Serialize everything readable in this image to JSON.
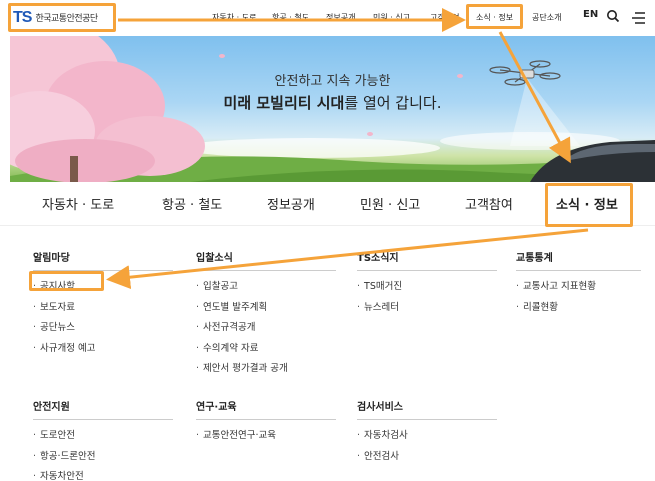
{
  "header": {
    "logo_mark": "TS",
    "logo_text": "한국교통안전공단",
    "top_nav": [
      "자동차 · 도로",
      "항공 · 철도",
      "정보공개",
      "민원 · 신고",
      "고객참여",
      "소식 · 정보",
      "공단소개"
    ],
    "lang_label": "EN"
  },
  "hero": {
    "line1": "안전하고 지속 가능한",
    "line2_bold": "미래 모빌리티 시대",
    "line2_rest": "를 열어 갑니다."
  },
  "gnb": {
    "items": [
      "자동차 · 도로",
      "항공 · 철도",
      "정보공개",
      "민원 · 신고",
      "고객참여",
      "소식 · 정보"
    ]
  },
  "mega": {
    "columns": [
      {
        "title": "알림마당",
        "items": [
          "공지사항",
          "보도자료",
          "공단뉴스",
          "사규개정 예고"
        ]
      },
      {
        "title": "입찰소식",
        "items": [
          "입찰공고",
          "연도별 발주계획",
          "사전규격공개",
          "수의계약 자료",
          "제안서 평가결과 공개"
        ]
      },
      {
        "title": "TS소식지",
        "items": [
          "TS매거진",
          "뉴스레터"
        ]
      },
      {
        "title": "교통통계",
        "items": [
          "교통사고 지표현황",
          "리콜현황"
        ]
      },
      {
        "title": "안전지원",
        "items": [
          "도로안전",
          "항공·드론안전",
          "자동차안전"
        ]
      },
      {
        "title": "연구·교육",
        "items": [
          "교통안전연구·교육"
        ]
      },
      {
        "title": "검사서비스",
        "items": [
          "자동차검사",
          "안전검사"
        ]
      }
    ]
  },
  "colors": {
    "highlight": "#f5a33a",
    "brand": "#1f59b8"
  }
}
